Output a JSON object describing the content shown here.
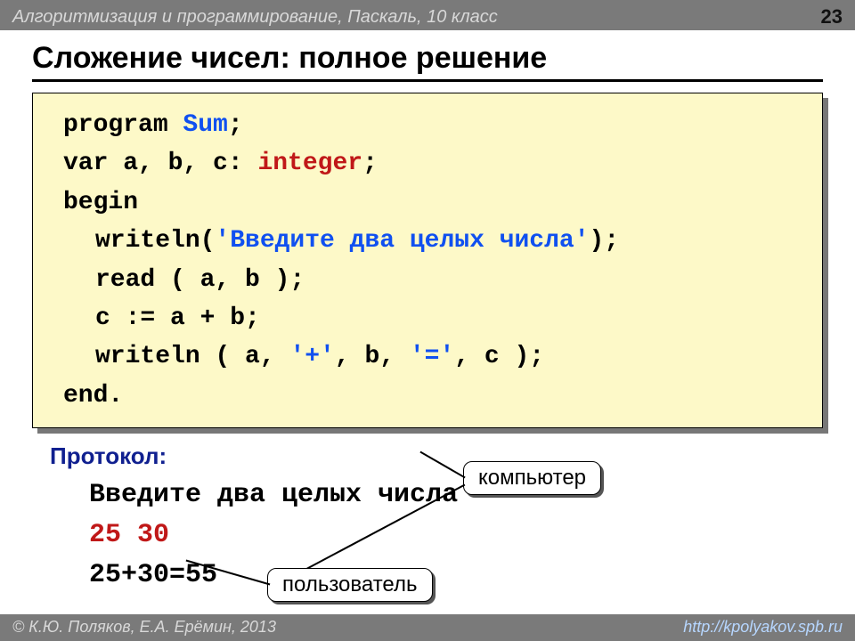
{
  "header": {
    "course": "Алгоритмизация и программирование, Паскаль, 10 класс",
    "page": "23"
  },
  "title": "Сложение чисел: полное решение",
  "code": {
    "l1_a": "program ",
    "l1_b": "Sum",
    "l1_c": ";",
    "l2_a": "var a, b, c: ",
    "l2_b": "integer",
    "l2_c": ";",
    "l3": "begin",
    "l4_a": "writeln(",
    "l4_b": "'Введите два целых числа'",
    "l4_c": ");",
    "l5": "read ( a, b );",
    "l6": "c := a + b;",
    "l7_a": "writeln ( a, ",
    "l7_b": "'+'",
    "l7_c": ", b, ",
    "l7_d": "'='",
    "l7_e": ", c );",
    "l8": "end."
  },
  "protocol": {
    "label": "Протокол:",
    "line1": "Введите два целых числа",
    "line2": "25 30",
    "line3": "25+30=55"
  },
  "callouts": {
    "computer": "компьютер",
    "user": "пользователь"
  },
  "footer": {
    "copyright": "© К.Ю. Поляков, Е.А. Ерёмин, 2013",
    "url": "http://kpolyakov.spb.ru"
  }
}
